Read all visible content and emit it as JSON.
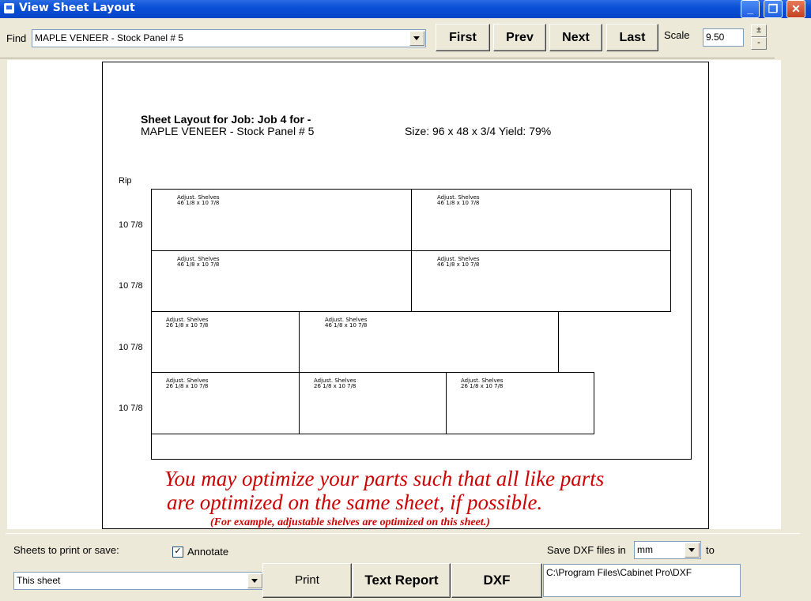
{
  "window": {
    "title": "View Sheet Layout",
    "buttons": {
      "minimize": "_",
      "maximize": "❐",
      "close": "✕"
    }
  },
  "toolbar": {
    "find_label": "Find",
    "find_value": "MAPLE VENEER - Stock Panel  # 5",
    "first": "First",
    "prev": "Prev",
    "next": "Next",
    "last": "Last",
    "scale_label": "Scale",
    "scale_value": "9.50",
    "spin_up": "±",
    "spin_down": "-"
  },
  "sheet": {
    "heading_line1": "Sheet Layout for Job: Job 4 for -",
    "heading_line2": "MAPLE VENEER - Stock Panel  # 5",
    "size_text": "Size: 96 x 48 x 3/4  Yield: 79%",
    "rip_label": "Rip",
    "rips": [
      "10 7/8",
      "10 7/8",
      "10 7/8",
      "10 7/8"
    ],
    "parts": [
      {
        "name": "Adjust. Shelves",
        "dims": "46 1/8 x 10 7/8"
      },
      {
        "name": "Adjust. Shelves",
        "dims": "46 1/8 x 10 7/8"
      },
      {
        "name": "Adjust. Shelves",
        "dims": "46 1/8 x 10 7/8"
      },
      {
        "name": "Adjust. Shelves",
        "dims": "46 1/8 x 10 7/8"
      },
      {
        "name": "Adjust. Shelves",
        "dims": "26 1/8 x 10 7/8"
      },
      {
        "name": "Adjust. Shelves",
        "dims": "46 1/8 x 10 7/8"
      },
      {
        "name": "Adjust. Shelves",
        "dims": "26 1/8 x 10 7/8"
      },
      {
        "name": "Adjust. Shelves",
        "dims": "26 1/8 x 10 7/8"
      },
      {
        "name": "Adjust. Shelves",
        "dims": "26 1/8 x 10 7/8"
      }
    ],
    "note_line1": "You may optimize your parts such that all like parts",
    "note_line2": "are optimized on the same sheet, if possible.",
    "note_line3": "(For example, adjustable shelves are optimized on this sheet.)"
  },
  "bottom": {
    "sheets_label": "Sheets to print or save:",
    "sheets_value": "This sheet",
    "annotate_label": "Annotate",
    "annotate_checked": "✓",
    "print": "Print",
    "text_report": "Text Report",
    "dxf": "DXF",
    "save_dxf_label": "Save DXF files in",
    "units_value": "mm",
    "to_label": "to",
    "dxf_path": "C:\\Program Files\\Cabinet Pro\\DXF"
  }
}
